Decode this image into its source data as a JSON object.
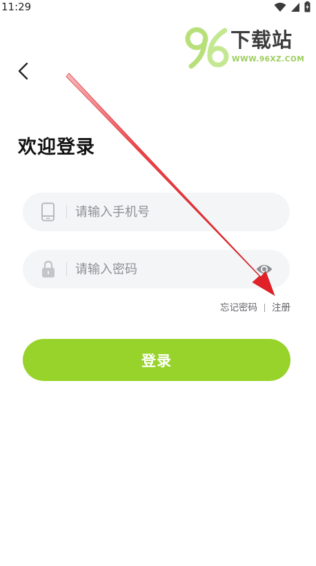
{
  "status_bar": {
    "time": "11:29",
    "icons": [
      "wifi-icon",
      "signal-icon",
      "battery-charging-icon"
    ]
  },
  "watermark": {
    "logo_number": "96",
    "site_name": "下载站",
    "url": "WWW.96XZ.COM"
  },
  "header": {
    "back_icon": "chevron-left-icon"
  },
  "title": "欢迎登录",
  "form": {
    "phone": {
      "icon": "phone-icon",
      "placeholder": "请输入手机号",
      "value": ""
    },
    "password": {
      "icon": "lock-icon",
      "placeholder": "请输入密码",
      "value": "",
      "toggle_icon": "eye-icon"
    }
  },
  "links": {
    "forgot_password": "忘记密码",
    "register": "注册"
  },
  "login_button": {
    "label": "登录"
  },
  "colors": {
    "accent": "#97d32a",
    "input_bg": "#f4f5f7",
    "placeholder": "#8e8f93",
    "arrow": "#e8141c"
  }
}
